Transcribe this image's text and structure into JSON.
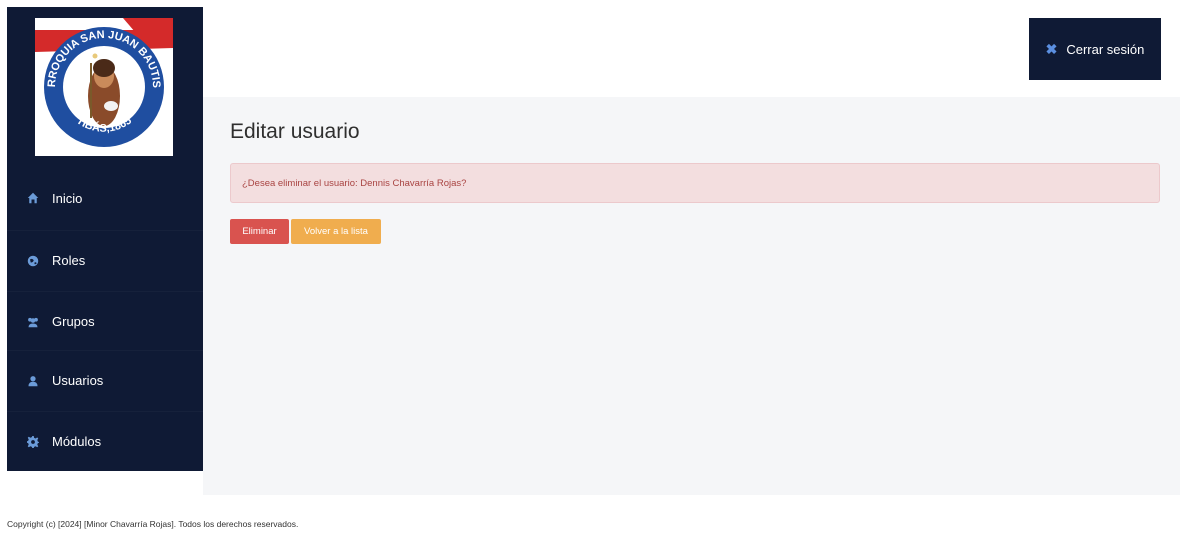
{
  "logo": {
    "ring_text_top": "PARROQUIA SAN JUAN BAUTISTA",
    "ring_text_bottom": "TIBÁS,1865",
    "colors": {
      "ring": "#1f4ea0",
      "banner": "#d42a2a"
    }
  },
  "sidebar": {
    "items": [
      {
        "label": "Inicio",
        "icon": "home-icon"
      },
      {
        "label": "Roles",
        "icon": "globe-icon"
      },
      {
        "label": "Grupos",
        "icon": "users-icon"
      },
      {
        "label": "Usuarios",
        "icon": "user-icon"
      },
      {
        "label": "Módulos",
        "icon": "gear-icon"
      }
    ]
  },
  "header": {
    "logout_label": "Cerrar sesión",
    "logout_icon": "close-icon"
  },
  "main": {
    "title": "Editar usuario",
    "alert_text": "¿Desea eliminar el usuario: Dennis Chavarría Rojas?",
    "delete_label": "Eliminar",
    "back_label": "Volver a la lista"
  },
  "footer": {
    "text": "Copyright (c) [2024] [Minor Chavarría Rojas]. Todos los derechos reservados."
  },
  "colors": {
    "sidebar_bg": "#0f1a35",
    "icon_accent": "#6b9bd8",
    "danger": "#d9534f",
    "warning": "#f0ad4e",
    "alert_bg": "#f3dedf"
  }
}
